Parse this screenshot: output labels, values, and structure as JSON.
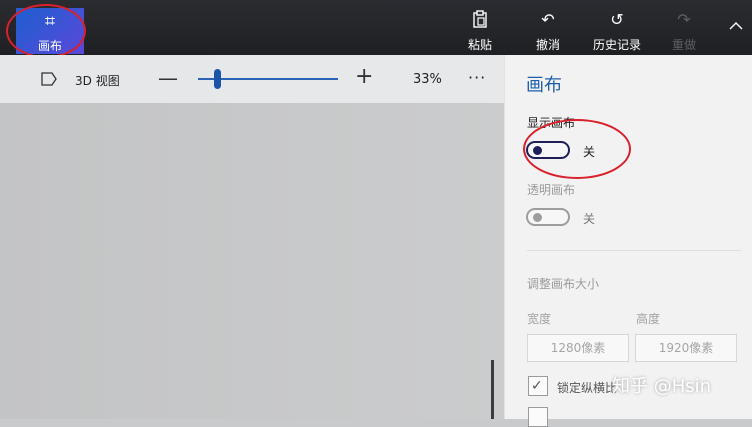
{
  "toolbar": {
    "canvas_label": "画布",
    "canvas_icon": "hash-icon",
    "paste_label": "粘贴",
    "undo_label": "撤消",
    "history_label": "历史记录",
    "redo_label": "重做"
  },
  "subbar": {
    "view3d_label": "3D 视图",
    "zoom_minus": "—",
    "zoom_plus": "+",
    "zoom_value": "33%",
    "zoom_level_fraction": 0.14,
    "more": "···"
  },
  "panel": {
    "title": "画布",
    "show_canvas_label": "显示画布",
    "show_canvas_state": "关",
    "transparent_canvas_label": "透明画布",
    "transparent_canvas_state": "关",
    "resize_label": "调整画布大小",
    "width_label": "宽度",
    "height_label": "高度",
    "width_value": "1280像素",
    "height_value": "1920像素",
    "lock_aspect_label": "锁定纵横比",
    "lock_aspect_checked": true
  },
  "watermark": "知乎 @Hsin",
  "colors": {
    "accent": "#1e5fa8",
    "annotation": "#d9212b",
    "toggle_on": "#1f1f5a"
  }
}
